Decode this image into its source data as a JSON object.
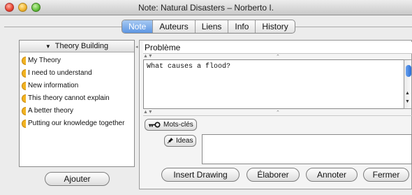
{
  "window": {
    "title": "Note: Natural Disasters  – Norberto I."
  },
  "tabs": [
    {
      "label": "Note",
      "active": true
    },
    {
      "label": "Auteurs",
      "active": false
    },
    {
      "label": "Liens",
      "active": false
    },
    {
      "label": "Info",
      "active": false
    },
    {
      "label": "History",
      "active": false
    }
  ],
  "sidebar": {
    "header": "Theory Building",
    "items": [
      "My Theory",
      "I need to understand",
      "New information",
      "This theory cannot explain",
      "A better theory",
      "Putting our knowledge together"
    ],
    "add_button": "Ajouter"
  },
  "problem": {
    "label": "Problème",
    "text": "What causes a flood?"
  },
  "keywords_button": "Mots-clés",
  "ideas_button": "Ideas",
  "actions": {
    "insert_drawing": "Insert Drawing",
    "elaborate": "Élaborer",
    "annotate": "Annoter",
    "close": "Fermer"
  },
  "colors": {
    "accent": "#5d96e3",
    "scaffold": "#f2b321"
  }
}
